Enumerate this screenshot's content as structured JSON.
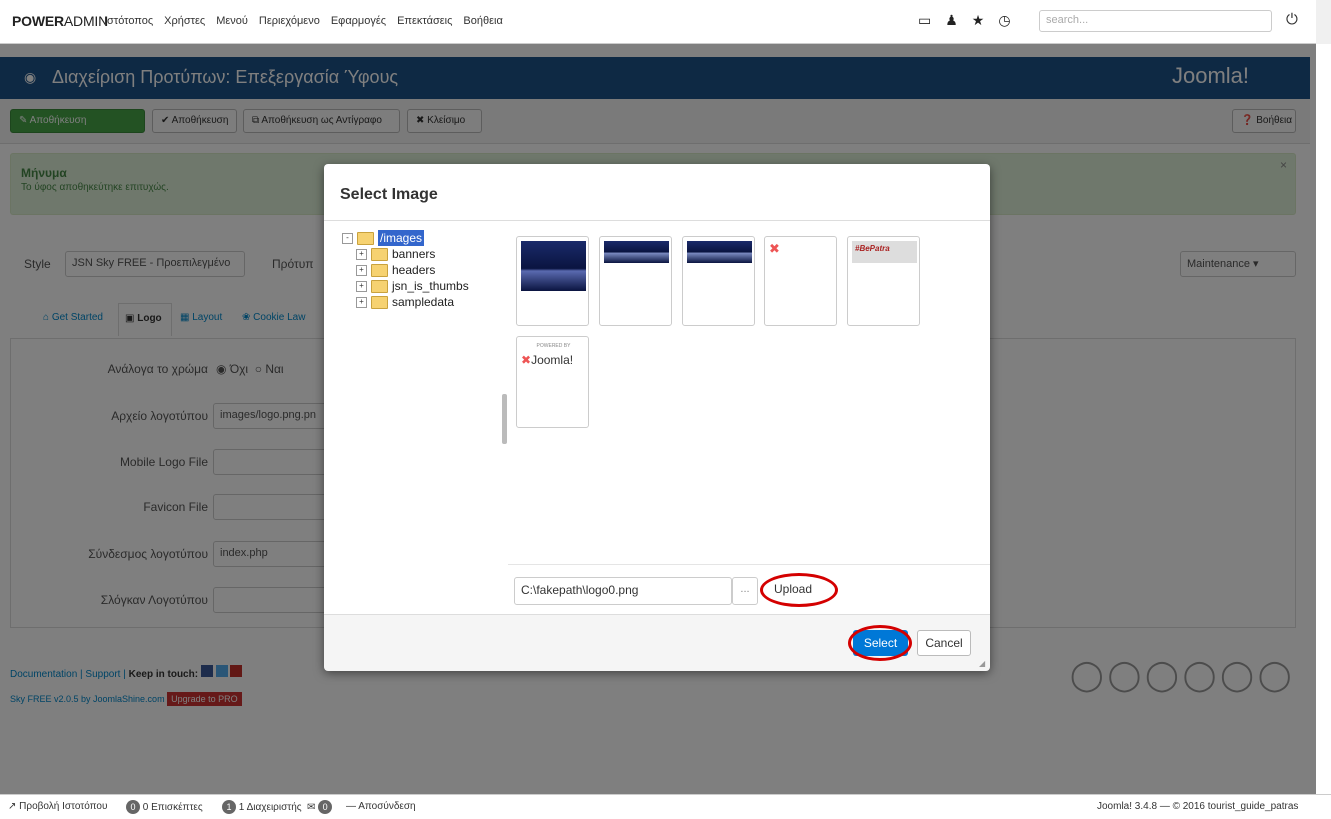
{
  "topbar": {
    "brand_bold": "POWER",
    "brand_thin": "ADMIN",
    "menu": [
      "Ιστότοπος",
      "Χρήστες",
      "Μενού",
      "Περιεχόμενο",
      "Εφαρμογές",
      "Επεκτάσεις",
      "Βοήθεια"
    ],
    "search_placeholder": "search..."
  },
  "title": {
    "text": "Διαχείριση Προτύπων: Επεξεργασία Ύφους",
    "brand": "Joomla!"
  },
  "toolbar": {
    "save": "Αποθήκευση",
    "save_close": "Αποθήκευση",
    "save_copy": "Αποθήκευση ως Αντίγραφο",
    "close": "Κλείσιμο",
    "help": "Βοήθεια"
  },
  "message": {
    "heading": "Μήνυμα",
    "text": "Το ύφος αποθηκεύτηκε επιτυχώς."
  },
  "style_row": {
    "label": "Style",
    "value": "JSN Sky FREE - Προεπιλεγμένο",
    "template_label": "Πρότυπ",
    "maintenance": "Maintenance"
  },
  "tabs": [
    "Get Started",
    "Logo",
    "Layout",
    "Cookie Law"
  ],
  "form": {
    "color_label": "Ανάλογα το χρώμα",
    "color_no": "Όχι",
    "color_yes": "Ναι",
    "logo_file_label": "Αρχείο λογοτύπου",
    "logo_file_value": "images/logo.png.pn",
    "mobile_logo_label": "Mobile Logo File",
    "favicon_label": "Favicon File",
    "logo_link_label": "Σύνδεσμος λογοτύπου",
    "logo_link_value": "index.php",
    "slogan_label": "Σλόγκαν Λογοτύπου"
  },
  "footer_links": {
    "documentation": "Documentation",
    "support": "Support",
    "keep_in_touch": "Keep in touch:",
    "credit": "Sky FREE v2.0.5 by JoomlaShine.com",
    "upgrade": "Upgrade to PRO"
  },
  "modal": {
    "title": "Select Image",
    "tree_root": "/images",
    "tree_children": [
      "banners",
      "headers",
      "jsn_is_thumbs",
      "sampledata"
    ],
    "thumb_text_bepatra": "#BePatra",
    "thumb_text_powered": "POWERED BY",
    "thumb_text_joomla": "Joomla!",
    "upload_path": "C:\\fakepath\\logo0.png",
    "browse": "...",
    "upload": "Upload",
    "select": "Select",
    "cancel": "Cancel"
  },
  "status": {
    "view_site": "Προβολή Ιστοτόπου",
    "visitors_count": "0",
    "visitors": "0 Επισκέπτες",
    "admins_count": "1",
    "admins": "1 Διαχειριστής",
    "messages_count": "0",
    "logout": "Αποσύνδεση",
    "version": "Joomla! 3.4.8 — © 2016 tourist_guide_patras"
  },
  "colors": {
    "header_blue": "#1d5288",
    "save_green": "#46a546",
    "message_bg": "#dff0d8",
    "highlight_red": "#d40000",
    "select_blue": "#0078d7"
  },
  "icons": [
    "monitor-icon",
    "user-icon",
    "star-icon",
    "clock-icon",
    "power-icon",
    "eye-icon",
    "joomla-logo-icon",
    "check-icon",
    "copy-icon",
    "close-circle-icon",
    "help-icon",
    "home-icon",
    "image-icon",
    "layout-icon",
    "cookie-icon",
    "folder-icon",
    "external-link-icon",
    "mail-icon"
  ]
}
